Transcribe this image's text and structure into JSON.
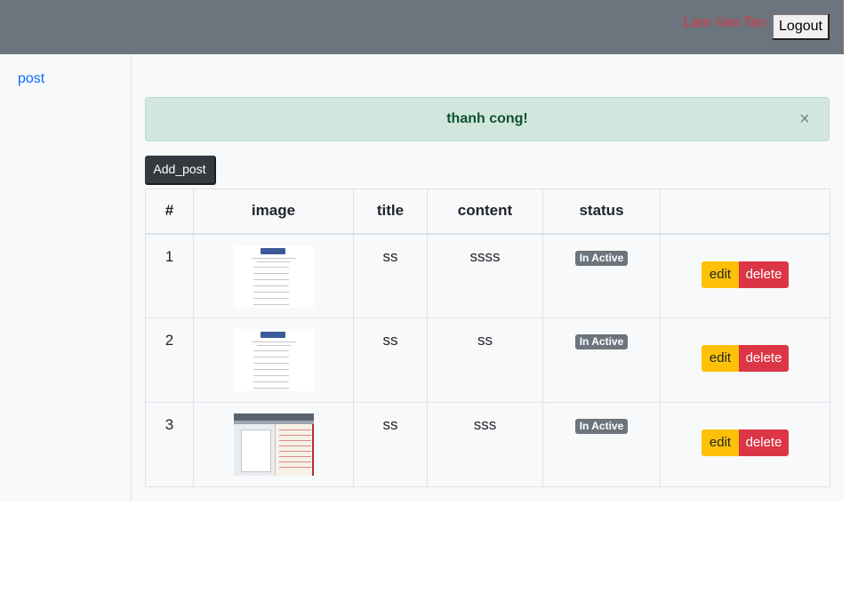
{
  "header": {
    "user_name": "Lam Van Tan",
    "logout_label": "Logout"
  },
  "sidebar": {
    "items": [
      {
        "label": "post"
      }
    ]
  },
  "alert": {
    "message": "thanh cong!",
    "close_glyph": "×"
  },
  "toolbar": {
    "add_label": "Add_post"
  },
  "table": {
    "headers": [
      "#",
      "image",
      "title",
      "content",
      "status",
      ""
    ],
    "rows": [
      {
        "id": "1",
        "image": "document-thumbnail",
        "title": "ss",
        "content": "ssss",
        "status": "In Active",
        "edit_label": "edit",
        "delete_label": "delete"
      },
      {
        "id": "2",
        "image": "document-thumbnail",
        "title": "ss",
        "content": "ss",
        "status": "In Active",
        "edit_label": "edit",
        "delete_label": "delete"
      },
      {
        "id": "3",
        "image": "screenshot-thumbnail",
        "title": "ss",
        "content": "sss",
        "status": "In Active",
        "edit_label": "edit",
        "delete_label": "delete"
      }
    ]
  },
  "colors": {
    "header_bg": "#6c757d",
    "user_name": "#dc3545",
    "success_bg": "#d1e7dd",
    "success_text": "#0f5132",
    "edit": "#ffc107",
    "delete": "#dc3545",
    "badge": "#6c757d"
  }
}
